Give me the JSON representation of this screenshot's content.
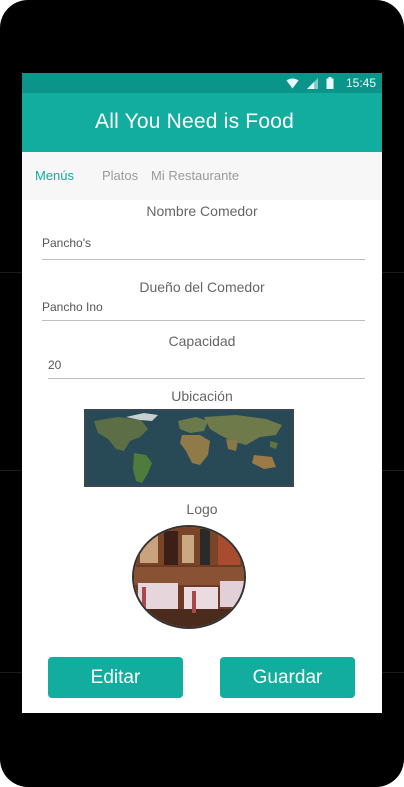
{
  "status_bar": {
    "time": "15:45"
  },
  "app_bar": {
    "title": "All You Need is Food"
  },
  "tabs": [
    {
      "label": "Menús",
      "active": true
    },
    {
      "label": "Platos",
      "active": false
    },
    {
      "label": "Mi Restaurante",
      "active": false
    }
  ],
  "form": {
    "nombre_label": "Nombre Comedor",
    "nombre_value": "Pancho's",
    "dueno_label": "Dueño del Comedor",
    "dueno_value": "Pancho Ino",
    "capacidad_label": "Capacidad",
    "capacidad_value": "20",
    "ubicacion_label": "Ubicación",
    "logo_label": "Logo"
  },
  "buttons": {
    "editar": "Editar",
    "guardar": "Guardar"
  },
  "icons": {
    "wifi": "wifi-icon",
    "signal": "signal-icon",
    "battery": "battery-icon",
    "map": "world-map-image",
    "logo": "restaurant-logo-image"
  },
  "colors": {
    "primary": "#12ad9e",
    "primary_dark": "#0b958a",
    "tab_background": "#f7f7f7"
  }
}
